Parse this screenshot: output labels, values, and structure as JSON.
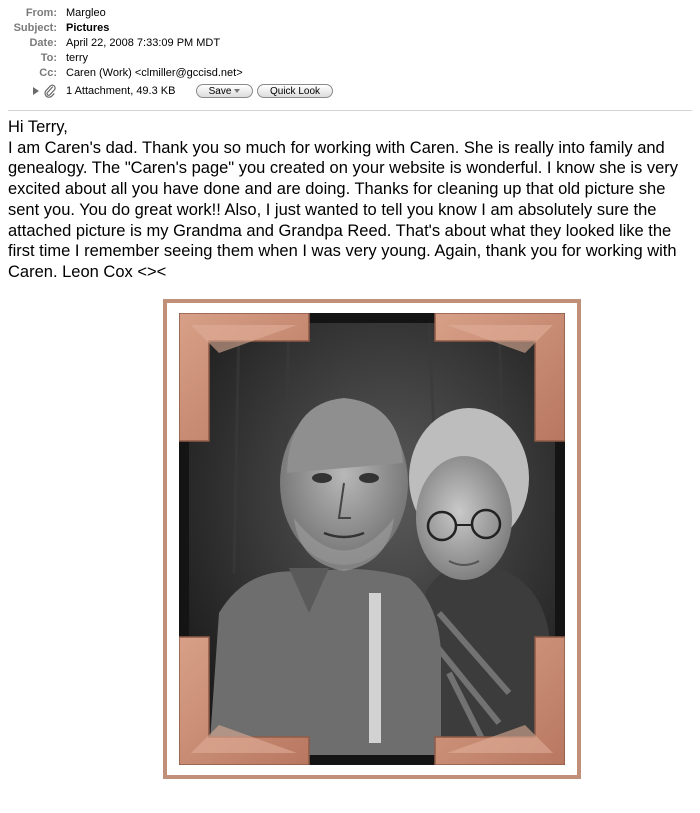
{
  "email": {
    "headers": [
      {
        "label": "From:",
        "value": "Margleo",
        "bold": false
      },
      {
        "label": "Subject:",
        "value": "Pictures",
        "bold": true
      },
      {
        "label": "Date:",
        "value": "April 22, 2008 7:33:09 PM MDT",
        "bold": false
      },
      {
        "label": "To:",
        "value": "terry",
        "bold": false
      },
      {
        "label": "Cc:",
        "value": "Caren (Work) <clmiller@gccisd.net>",
        "bold": false
      }
    ],
    "attachment": {
      "summary": "1 Attachment, 49.3 KB",
      "save_label": "Save",
      "quicklook_label": "Quick Look"
    },
    "body": {
      "greeting": "Hi Terry,",
      "message": "I am Caren's dad. Thank you so much for working with Caren. She is really into family and genealogy. The \"Caren's page\" you created on your website is wonderful. I know she is very excited about all you have done and are doing. Thanks for cleaning up that old picture she sent you. You do great work!! Also, I just wanted to tell you know I am absolutely sure the attached picture is my Grandma and Grandpa Reed. That's about what they looked like the first time I remember seeing them when I was very young. Again, thank you for working with Caren.   Leon Cox <><"
    }
  },
  "colors": {
    "frame_border": "#c1907a",
    "photo_corner": "#c98a70",
    "label_gray": "#7a7a7a"
  },
  "icons": [
    "disclosure-triangle-icon",
    "paperclip-icon"
  ]
}
